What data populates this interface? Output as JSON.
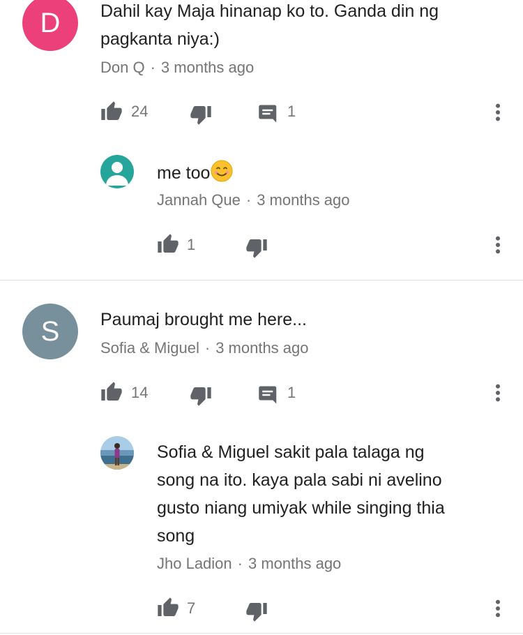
{
  "colors": {
    "avatar_d": "#ec407a",
    "avatar_s": "#78909c",
    "avatar_default": "#26a69a",
    "icon": "#5f6368",
    "meta": "#757575"
  },
  "comments": [
    {
      "avatar_letter": "D",
      "text_lines": [
        "Dahil kay Maja hinanap ko to. Ganda din ng",
        "pagkanta niya:)"
      ],
      "author": "Don Q",
      "separator": "·",
      "time": "3 months ago",
      "likes": "24",
      "replies": "1",
      "reply": {
        "text": "me too",
        "author": "Jannah Que",
        "separator": "·",
        "time": "3 months ago",
        "likes": "1"
      }
    },
    {
      "avatar_letter": "S",
      "text_lines": [
        "Paumaj brought me here..."
      ],
      "author": "Sofia & Miguel",
      "separator": "·",
      "time": "3 months ago",
      "likes": "14",
      "replies": "1",
      "reply": {
        "text_lines": [
          "Sofia & Miguel sakit pala talaga ng",
          "song na ito. kaya pala sabi ni avelino",
          "gusto niang umiyak while singing thia",
          "song"
        ],
        "author": "Jho Ladion",
        "separator": "·",
        "time": "3 months ago",
        "likes": "7"
      }
    }
  ],
  "icons": [
    "like-icon",
    "dislike-icon",
    "reply-icon",
    "more-options-icon",
    "smiling-emoji-icon",
    "default-avatar-icon"
  ]
}
